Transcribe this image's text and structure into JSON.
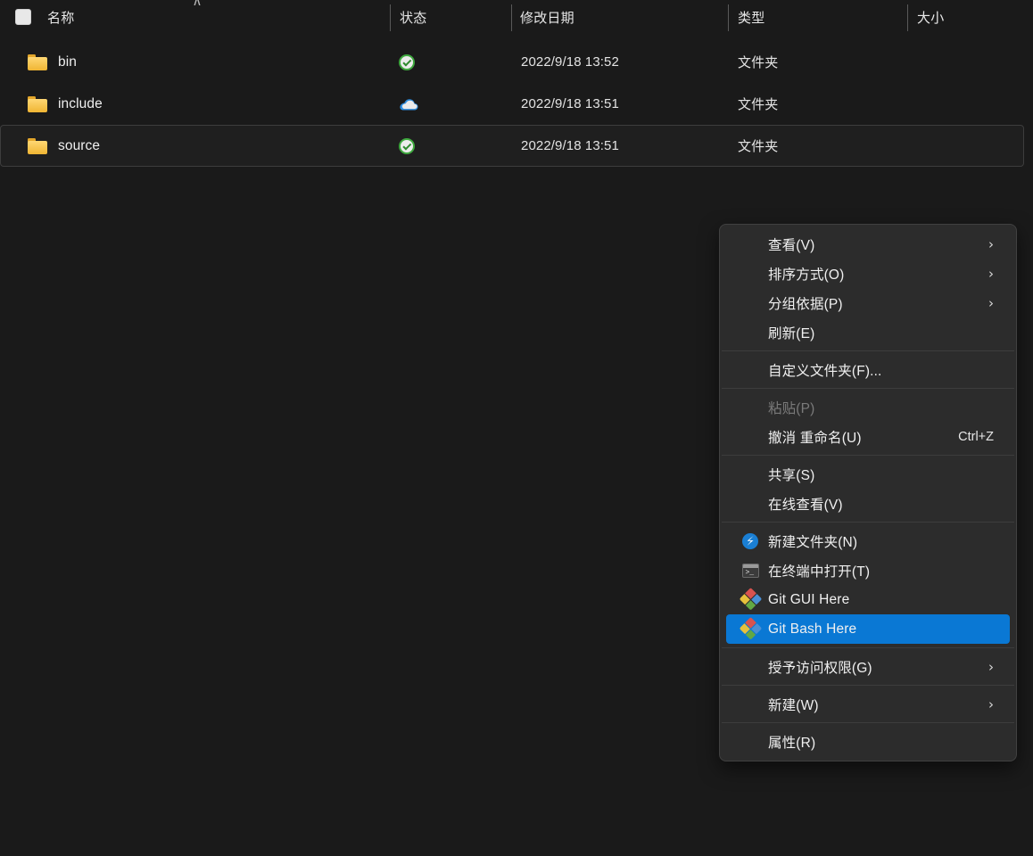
{
  "file_list": {
    "columns": [
      {
        "key": "name",
        "label": "名称"
      },
      {
        "key": "status",
        "label": "状态"
      },
      {
        "key": "date",
        "label": "修改日期"
      },
      {
        "key": "type",
        "label": "类型"
      },
      {
        "key": "size",
        "label": "大小"
      }
    ],
    "sort": {
      "column": "名称",
      "direction": "ascending",
      "indicator": "sort-ascending-chevron"
    },
    "select_all_checkbox": {
      "icon": "checkbox",
      "checked": false
    },
    "rows": [
      {
        "name": "bin",
        "icon": "folder-icon",
        "status_icon": "onedrive-available-check",
        "date": "2022/9/18 13:52",
        "type": "文件夹",
        "size": "",
        "selected": false
      },
      {
        "name": "include",
        "icon": "folder-icon",
        "status_icon": "onedrive-cloud",
        "date": "2022/9/18 13:51",
        "type": "文件夹",
        "size": "",
        "selected": false
      },
      {
        "name": "source",
        "icon": "folder-icon",
        "status_icon": "onedrive-available-check",
        "date": "2022/9/18 13:51",
        "type": "文件夹",
        "size": "",
        "selected": true
      }
    ]
  },
  "context_menu": {
    "groups": [
      {
        "items": [
          {
            "label": "查看(V)",
            "icon": "",
            "submenu": true,
            "accel": "",
            "disabled": false,
            "highlighted": false
          },
          {
            "label": "排序方式(O)",
            "icon": "",
            "submenu": true,
            "accel": "",
            "disabled": false,
            "highlighted": false
          },
          {
            "label": "分组依据(P)",
            "icon": "",
            "submenu": true,
            "accel": "",
            "disabled": false,
            "highlighted": false
          },
          {
            "label": "刷新(E)",
            "icon": "",
            "submenu": false,
            "accel": "",
            "disabled": false,
            "highlighted": false
          }
        ]
      },
      {
        "items": [
          {
            "label": "自定义文件夹(F)...",
            "icon": "",
            "submenu": false,
            "accel": "",
            "disabled": false,
            "highlighted": false
          }
        ]
      },
      {
        "items": [
          {
            "label": "粘贴(P)",
            "icon": "",
            "submenu": false,
            "accel": "",
            "disabled": true,
            "highlighted": false
          },
          {
            "label": "撤消 重命名(U)",
            "icon": "",
            "submenu": false,
            "accel": "Ctrl+Z",
            "disabled": false,
            "highlighted": false
          }
        ]
      },
      {
        "items": [
          {
            "label": "共享(S)",
            "icon": "",
            "submenu": false,
            "accel": "",
            "disabled": false,
            "highlighted": false
          },
          {
            "label": "在线查看(V)",
            "icon": "",
            "submenu": false,
            "accel": "",
            "disabled": false,
            "highlighted": false
          }
        ]
      },
      {
        "items": [
          {
            "label": "新建文件夹(N)",
            "icon": "new-folder-icon",
            "submenu": false,
            "accel": "",
            "disabled": false,
            "highlighted": false
          },
          {
            "label": "在终端中打开(T)",
            "icon": "terminal-icon",
            "submenu": false,
            "accel": "",
            "disabled": false,
            "highlighted": false
          },
          {
            "label": "Git GUI Here",
            "icon": "git-icon",
            "submenu": false,
            "accel": "",
            "disabled": false,
            "highlighted": false
          },
          {
            "label": "Git Bash Here",
            "icon": "git-icon",
            "submenu": false,
            "accel": "",
            "disabled": false,
            "highlighted": true
          }
        ]
      },
      {
        "items": [
          {
            "label": "授予访问权限(G)",
            "icon": "",
            "submenu": true,
            "accel": "",
            "disabled": false,
            "highlighted": false
          }
        ]
      },
      {
        "items": [
          {
            "label": "新建(W)",
            "icon": "",
            "submenu": true,
            "accel": "",
            "disabled": false,
            "highlighted": false
          }
        ]
      },
      {
        "items": [
          {
            "label": "属性(R)",
            "icon": "",
            "submenu": false,
            "accel": "",
            "disabled": false,
            "highlighted": false
          }
        ]
      }
    ],
    "submenu_glyph": "›",
    "sort_glyph": "∧"
  },
  "colors": {
    "background": "#1a1a1a",
    "menu_background": "#2c2c2c",
    "accent_highlight": "#0a78d4",
    "folder_yellow": "#f0b533",
    "status_check_green": "#3fa93f",
    "status_cloud_blue": "#2f8fe0"
  }
}
